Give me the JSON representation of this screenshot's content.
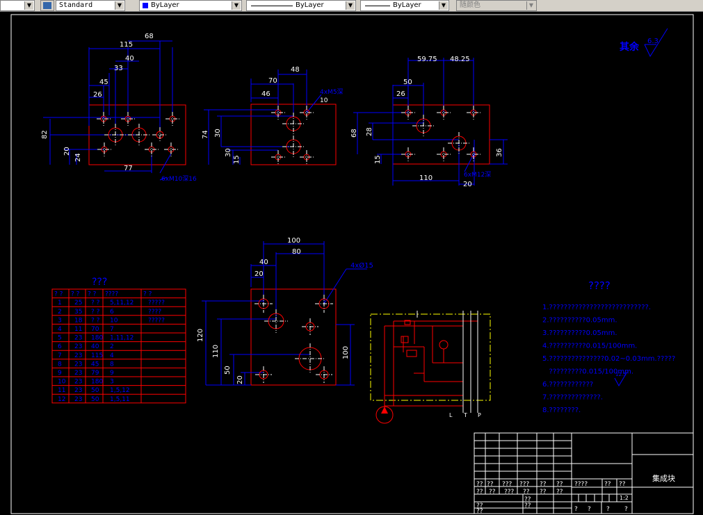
{
  "toolbar": {
    "text_style": "Standard",
    "layer": "ByLayer",
    "linetype": "ByLayer",
    "lineweight": "ByLayer",
    "plot_style": "随颜色",
    "colors": {
      "layer_swatch": "#0000ff"
    }
  },
  "drawing": {
    "colors": {
      "background": "#000000",
      "outline": "#ff0000",
      "dimension": "#0000ff",
      "center": "#ffffff",
      "note": "#0000ff",
      "hydraulic": "#ffff00"
    },
    "roughness": {
      "label": "其余",
      "value": "6.3"
    },
    "plate1": {
      "dims": [
        "68",
        "115",
        "40",
        "33",
        "45",
        "26",
        "82",
        "20",
        "24",
        "77"
      ],
      "note": "6xM10深16"
    },
    "plate2": {
      "dims": [
        "48",
        "70",
        "46",
        "74",
        "30",
        "30",
        "15"
      ],
      "note": "4xM5深",
      "note_depth": "10"
    },
    "plate3": {
      "dims": [
        "59.75",
        "48.25",
        "50",
        "26",
        "68",
        "28",
        "15",
        "110",
        "20",
        "36"
      ],
      "note": "6xM12深"
    },
    "plate4": {
      "dims": [
        "100",
        "80",
        "40",
        "20",
        "120",
        "110",
        "100",
        "50",
        "20"
      ],
      "note": "4xØ15"
    },
    "table": {
      "title": "???",
      "headers": [
        "? ?",
        "? ?",
        "? ?",
        "????",
        "? ?"
      ],
      "rows": [
        [
          "1",
          "25",
          "? ?",
          "5,11,12",
          "?????"
        ],
        [
          "2",
          "35",
          "? ?",
          "6",
          "????"
        ],
        [
          "3",
          "18",
          "? ?",
          "10",
          "?????"
        ],
        [
          "4",
          "11",
          "70",
          "7",
          ""
        ],
        [
          "5",
          "23",
          "180",
          "1,11,12",
          ""
        ],
        [
          "6",
          "23",
          "40",
          "2",
          ""
        ],
        [
          "7",
          "23",
          "115",
          "4",
          ""
        ],
        [
          "8",
          "23",
          "45",
          "8",
          ""
        ],
        [
          "9",
          "23",
          "79",
          "9",
          ""
        ],
        [
          "10",
          "23",
          "180",
          "3",
          ""
        ],
        [
          "11",
          "23",
          "50",
          "1,5,12",
          ""
        ],
        [
          "12",
          "23",
          "50",
          "1,5,11",
          ""
        ]
      ]
    },
    "notes": {
      "title": "????",
      "items": [
        "1.???????????????????????????.",
        "2.??????????0.05mm.",
        "3.??????????0.05mm.",
        "4.??????????0.015/100mm.",
        "5.???????????????0.02~0.03mm.?????",
        "   ?????????0.015/100mm.",
        "6.????????????",
        "7.??????????????.",
        "8.????????."
      ],
      "item6_symbol": "12.5"
    },
    "hydraulic": {
      "port_labels": [
        "L",
        "T",
        "P"
      ]
    },
    "title_block": {
      "drawing_name": "集成块",
      "scale": "1:2",
      "q2": "??",
      "q3": "???",
      "q4": "????"
    }
  }
}
